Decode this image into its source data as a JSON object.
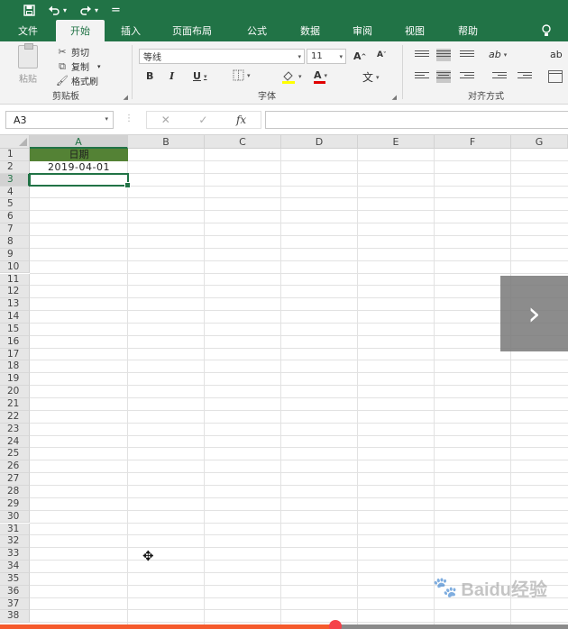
{
  "quick_access": {
    "save_icon": "save-icon",
    "undo_icon": "undo-icon",
    "redo_icon": "redo-icon",
    "customize_glyph": "="
  },
  "tabs": [
    {
      "label": "文件",
      "active": false
    },
    {
      "label": "开始",
      "active": true
    },
    {
      "label": "插入",
      "active": false
    },
    {
      "label": "页面布局",
      "active": false
    },
    {
      "label": "公式",
      "active": false
    },
    {
      "label": "数据",
      "active": false
    },
    {
      "label": "审阅",
      "active": false
    },
    {
      "label": "视图",
      "active": false
    },
    {
      "label": "帮助",
      "active": false
    }
  ],
  "ribbon": {
    "clipboard": {
      "paste_label": "粘贴",
      "cut_label": "剪切",
      "copy_label": "复制",
      "format_painter_label": "格式刷",
      "group_label": "剪贴板"
    },
    "font": {
      "font_name": "等线",
      "font_size": "11",
      "grow_label": "A",
      "shrink_label": "A",
      "bold": "B",
      "italic": "I",
      "underline": "U",
      "font_color_glyph": "A",
      "phonetic_glyph": "文",
      "group_label": "字体"
    },
    "alignment": {
      "orientation_glyph": "ab",
      "group_label": "对齐方式",
      "wrap_glyph": "ab"
    }
  },
  "formula_bar": {
    "name_box": "A3",
    "cancel_glyph": "✕",
    "enter_glyph": "✓",
    "fx_glyph": "fx",
    "value": ""
  },
  "sheet": {
    "columns": [
      "A",
      "B",
      "C",
      "D",
      "E",
      "F",
      "G"
    ],
    "rows": [
      "1",
      "2",
      "3",
      "4",
      "5",
      "6",
      "7",
      "8",
      "9",
      "10",
      "11",
      "12",
      "13",
      "14",
      "15",
      "16",
      "17",
      "18",
      "19",
      "20",
      "21",
      "22",
      "23",
      "24",
      "25",
      "26",
      "27",
      "28",
      "29",
      "30",
      "31",
      "32",
      "33",
      "34",
      "35",
      "36",
      "37",
      "38"
    ],
    "selected_column": "A",
    "selected_row": "3",
    "cells": {
      "A1": "日期",
      "A2": "2019-04-01"
    },
    "header_fill_color": "#548235"
  },
  "overlay": {
    "next_glyph": "›",
    "watermark_text": "Baidu经验",
    "progress_fraction": 0.59
  },
  "colors": {
    "excel_green": "#217346",
    "progress_orange": "#f55a2c"
  }
}
